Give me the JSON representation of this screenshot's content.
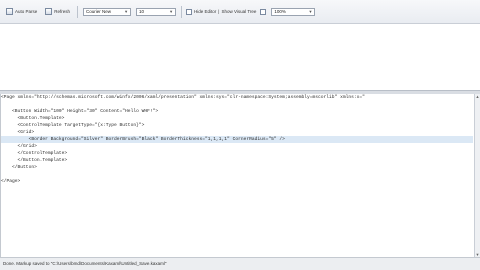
{
  "toolbar": {
    "auto_parse_label": "Auto Parse",
    "refresh_label": "Refresh",
    "font_family": "Courier New",
    "font_size": "10",
    "hide_editor_label": "Hide Editor",
    "show_visual_tree_label": "Show Visual Tree",
    "zoom": "100%"
  },
  "code": {
    "lines": [
      "<Page xmlns=\"http://schemas.microsoft.com/winfx/2006/xaml/presentation\" xmlns:sys=\"clr-namespace:System;assembly=mscorlib\" xmlns:x=\"",
      "",
      "    <Button Width=\"100\" Height=\"30\" Content=\"Hello WHF!\">",
      "      <Button.Template>",
      "      <ControlTemplate TargetType=\"{x:Type Button}\">",
      "      <Grid>",
      "          <Border Background=\"Silver\" BorderBrush=\"Black\" BorderThickness=\"1,1,1,1\" CornerRadius=\"5\" />",
      "      </Grid>",
      "      </ControlTemplate>",
      "      </Button.Template>",
      "    </Button>",
      "",
      "</Page>"
    ]
  },
  "status": {
    "text": "Done. Markup saved to \"C:\\Users\\bmd\\Documents\\Kaxaml\\Untitled_Save.kaxaml\""
  }
}
